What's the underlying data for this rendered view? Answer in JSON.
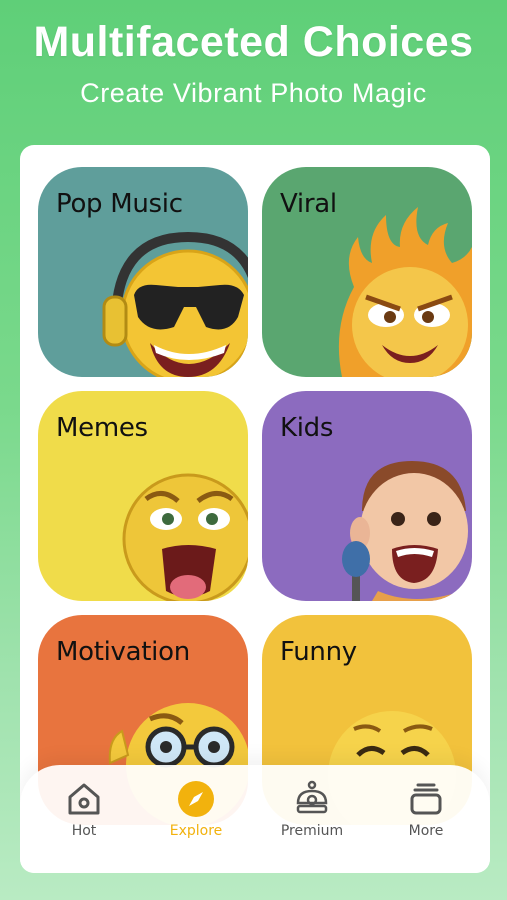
{
  "header": {
    "title": "Multifaceted Choices",
    "subtitle": "Create Vibrant Photo Magic"
  },
  "categories": [
    {
      "label": "Pop Music",
      "color": "#5f9e9b"
    },
    {
      "label": "Viral",
      "color": "#5aa670"
    },
    {
      "label": "Memes",
      "color": "#f0dc4a"
    },
    {
      "label": "Kids",
      "color": "#8c6bbf"
    },
    {
      "label": "Motivation",
      "color": "#e8743e"
    },
    {
      "label": "Funny",
      "color": "#f2c23c"
    }
  ],
  "nav": {
    "items": [
      {
        "label": "Hot",
        "icon": "home-icon"
      },
      {
        "label": "Explore",
        "icon": "compass-icon"
      },
      {
        "label": "Premium",
        "icon": "crown-icon"
      },
      {
        "label": "More",
        "icon": "stack-icon"
      }
    ],
    "active": "Explore",
    "active_color": "#f2b20d"
  }
}
